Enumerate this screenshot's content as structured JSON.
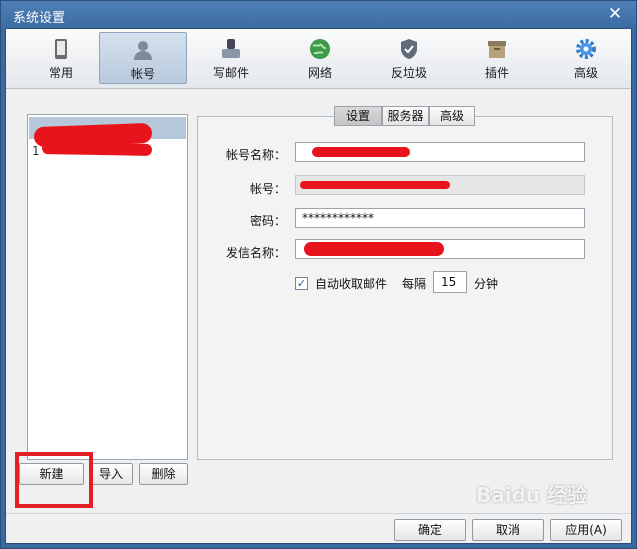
{
  "window": {
    "title": "系统设置",
    "close_glyph": "✕"
  },
  "toolbar": {
    "items": [
      {
        "label": "常用",
        "icon": "phone-icon"
      },
      {
        "label": "帐号",
        "icon": "user-icon"
      },
      {
        "label": "写邮件",
        "icon": "compose-icon"
      },
      {
        "label": "网络",
        "icon": "globe-icon"
      },
      {
        "label": "反垃圾",
        "icon": "shield-icon"
      },
      {
        "label": "插件",
        "icon": "plugin-box-icon"
      },
      {
        "label": "高级",
        "icon": "gear-icon"
      }
    ],
    "active_index": 1
  },
  "account_list": {
    "items": [
      {
        "label": "1"
      }
    ]
  },
  "left_buttons": {
    "new": "新建",
    "import": "导入",
    "delete": "删除"
  },
  "subtabs": {
    "items": [
      "设置",
      "服务器",
      "高级"
    ],
    "active_index": 0
  },
  "form": {
    "account_name_label": "帐号名称：",
    "account_label": "帐号：",
    "password_label": "密码：",
    "password_value": "************",
    "sender_label": "发信名称：",
    "auto_receive_label": "自动收取邮件",
    "auto_receive_checked": true,
    "check_glyph": "✓",
    "every_label": "每隔",
    "interval_value": "15",
    "unit_label": "分钟"
  },
  "footer": {
    "ok": "确定",
    "cancel": "取消",
    "apply": "应用(A)"
  },
  "watermark": "Baidu 经验",
  "colors": {
    "accent": "#3a6aa0",
    "highlight_red": "#e21f26",
    "redaction": "#e8141b"
  }
}
